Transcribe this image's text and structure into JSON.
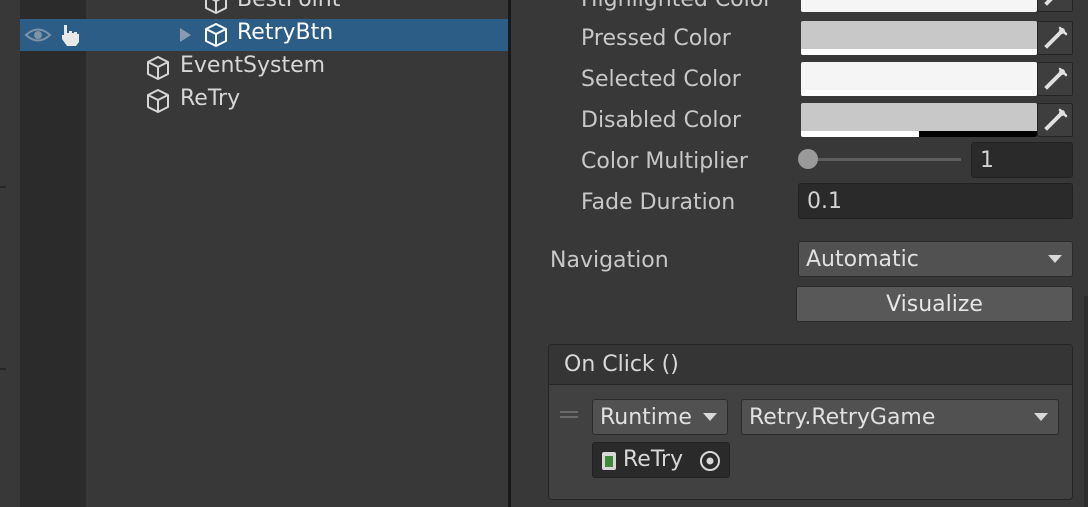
{
  "hierarchy": {
    "items": [
      {
        "name": "BestPoint",
        "indent": 2,
        "selected": false
      },
      {
        "name": "RetryBtn",
        "indent": 2,
        "selected": true
      },
      {
        "name": "EventSystem",
        "indent": 1,
        "selected": false
      },
      {
        "name": "ReTry",
        "indent": 1,
        "selected": false
      }
    ]
  },
  "inspector": {
    "colors": {
      "highlighted_label": "Highlighted Color",
      "highlighted_value": "#F5F5F5",
      "pressed_label": "Pressed Color",
      "pressed_value": "#C8C8C8",
      "selected_label": "Selected Color",
      "selected_value": "#F5F5F5",
      "disabled_label": "Disabled Color",
      "disabled_value": "#C8C8C8",
      "disabled_alpha": 0.5
    },
    "color_multiplier_label": "Color Multiplier",
    "color_multiplier_value": "1",
    "color_multiplier_slider": 0.0,
    "fade_duration_label": "Fade Duration",
    "fade_duration_value": "0.1",
    "navigation_label": "Navigation",
    "navigation_value": "Automatic",
    "visualize_label": "Visualize",
    "on_click": {
      "title": "On Click ()",
      "runtime_value": "Runtime",
      "function_value": "Retry.RetryGame",
      "object_value": "ReTry"
    }
  },
  "theme": {
    "selection": "#2C5D87",
    "panel": "#383838"
  }
}
